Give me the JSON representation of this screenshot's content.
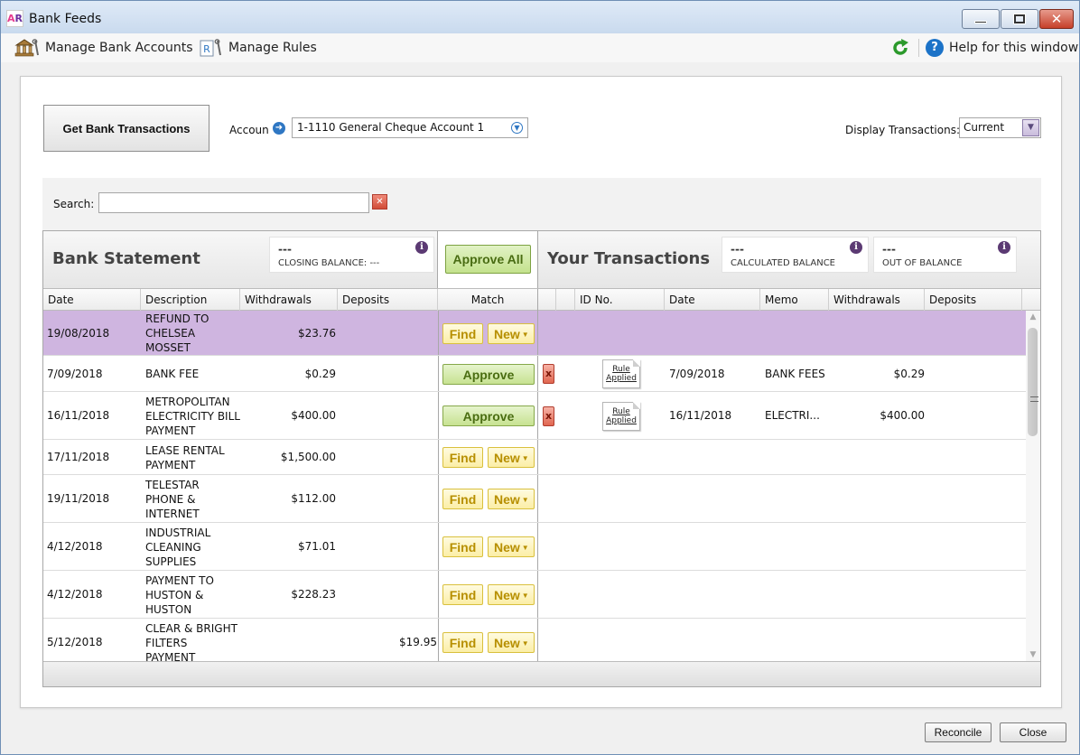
{
  "window": {
    "title": "Bank Feeds",
    "logo": "AR"
  },
  "toolbar": {
    "manage_accounts": "Manage Bank Accounts",
    "manage_rules": "Manage Rules",
    "help": "Help for this window"
  },
  "controls": {
    "get_transactions": "Get Bank Transactions",
    "account_label": "Accoun",
    "account_value": "1-1110 General Cheque Account 1",
    "display_label": "Display Transactions:",
    "display_value": "Current",
    "search_label": "Search:",
    "search_value": ""
  },
  "bank_statement": {
    "title": "Bank Statement",
    "closing_value": "---",
    "closing_caption": "CLOSING BALANCE: ---"
  },
  "match_header": {
    "approve_all": "Approve All"
  },
  "your_transactions": {
    "title": "Your Transactions",
    "calc_value": "---",
    "calc_caption": "CALCULATED BALANCE",
    "oob_value": "---",
    "oob_caption": "OUT OF BALANCE"
  },
  "columns": {
    "date": "Date",
    "description": "Description",
    "withdrawals": "Withdrawals",
    "deposits": "Deposits",
    "match": "Match",
    "id_no": "ID No.",
    "y_date": "Date",
    "memo": "Memo",
    "y_withdrawals": "Withdrawals",
    "y_deposits": "Deposits"
  },
  "labels": {
    "find": "Find",
    "new": "New",
    "approve": "Approve",
    "remove": "x",
    "rule_applied_1": "Rule",
    "rule_applied_2": "Applied"
  },
  "rows": [
    {
      "date": "19/08/2018",
      "desc": [
        "REFUND TO",
        "CHELSEA",
        "MOSSET"
      ],
      "withdrawal": "$23.76",
      "deposit": "",
      "match": "find",
      "selected": true
    },
    {
      "date": "7/09/2018",
      "desc": [
        "BANK FEE"
      ],
      "withdrawal": "$0.29",
      "deposit": "",
      "match": "approve",
      "yours": {
        "date": "7/09/2018",
        "memo": "BANK FEES",
        "withdrawal": "$0.29"
      }
    },
    {
      "date": "16/11/2018",
      "desc": [
        "METROPOLITAN",
        "ELECTRICITY BILL",
        "PAYMENT"
      ],
      "withdrawal": "$400.00",
      "deposit": "",
      "match": "approve",
      "yours": {
        "date": "16/11/2018",
        "memo": "ELECTRI...",
        "withdrawal": "$400.00"
      }
    },
    {
      "date": "17/11/2018",
      "desc": [
        "LEASE RENTAL",
        "PAYMENT"
      ],
      "withdrawal": "$1,500.00",
      "deposit": "",
      "match": "find"
    },
    {
      "date": "19/11/2018",
      "desc": [
        "TELESTAR",
        "PHONE &",
        "INTERNET"
      ],
      "withdrawal": "$112.00",
      "deposit": "",
      "match": "find"
    },
    {
      "date": "4/12/2018",
      "desc": [
        "INDUSTRIAL",
        "CLEANING",
        "SUPPLIES"
      ],
      "withdrawal": "$71.01",
      "deposit": "",
      "match": "find"
    },
    {
      "date": "4/12/2018",
      "desc": [
        "PAYMENT TO",
        "HUSTON &",
        "HUSTON"
      ],
      "withdrawal": "$228.23",
      "deposit": "",
      "match": "find"
    },
    {
      "date": "5/12/2018",
      "desc": [
        "CLEAR & BRIGHT",
        "FILTERS",
        "PAYMENT"
      ],
      "withdrawal": "",
      "deposit": "$19.95",
      "match": "find"
    }
  ],
  "footer": {
    "reconcile": "Reconcile",
    "close": "Close"
  },
  "colors": {
    "selected_row": "#cfb5e0",
    "approve_green": "#c7e291",
    "find_yellow": "#fbeea6",
    "accent_blue": "#1c73c8"
  },
  "icons": [
    "bank-icon",
    "rules-icon",
    "refresh-icon",
    "help-icon",
    "info-icon",
    "remove-icon",
    "rule-applied-icon",
    "dropdown-icon",
    "clear-icon"
  ]
}
